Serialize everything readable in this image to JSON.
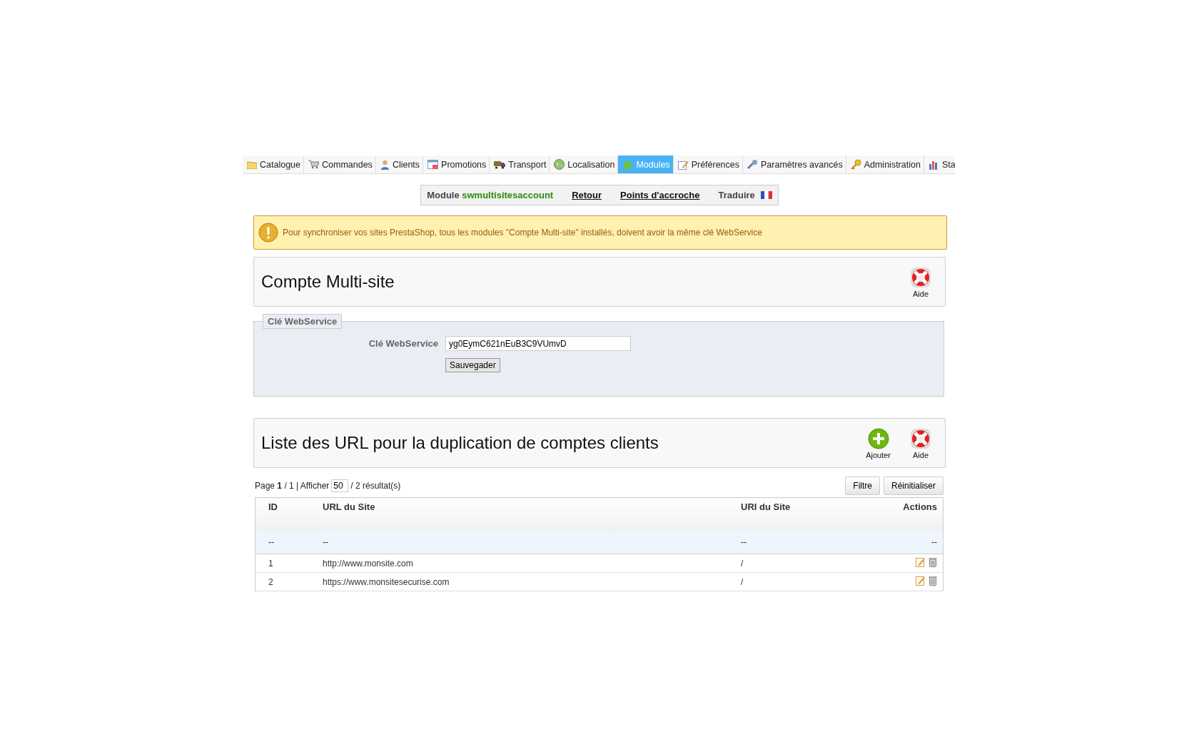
{
  "tabs": [
    {
      "label": "Catalogue",
      "kind": "folder",
      "selected": false
    },
    {
      "label": "Commandes",
      "kind": "cart",
      "selected": false
    },
    {
      "label": "Clients",
      "kind": "person",
      "selected": false
    },
    {
      "label": "Promotions",
      "kind": "promo",
      "selected": false
    },
    {
      "label": "Transport",
      "kind": "truck",
      "selected": false
    },
    {
      "label": "Localisation",
      "kind": "globe",
      "selected": false
    },
    {
      "label": "Modules",
      "kind": "puzzle",
      "selected": true
    },
    {
      "label": "Préférences",
      "kind": "pencil",
      "selected": false
    },
    {
      "label": "Paramètres avancés",
      "kind": "wrench",
      "selected": false
    },
    {
      "label": "Administration",
      "kind": "key",
      "selected": false
    },
    {
      "label": "Sta",
      "kind": "chart",
      "selected": false
    }
  ],
  "module_bar": {
    "label": "Module",
    "module_name": "swmultisitesaccount",
    "links": [
      "Retour",
      "Points d'accroche"
    ],
    "translate": "Traduire"
  },
  "alert": "Pour synchroniser vos sites PrestaShop, tous les modules \"Compte Multi-site\" installés, doivent avoir la même clé WebService",
  "account_panel": {
    "title": "Compte Multi-site",
    "actions": [
      {
        "kind": "help",
        "label": "Aide"
      }
    ]
  },
  "webservice_form": {
    "legend": "Clé WebService",
    "field_label": "Clé WebService",
    "value": "yg0EymC621nEuB3C9VUmvD",
    "button": "Sauvegader"
  },
  "url_panel": {
    "title": "Liste des URL pour la duplication de comptes clients",
    "actions": [
      {
        "kind": "add",
        "label": "Ajouter"
      },
      {
        "kind": "help",
        "label": "Aide"
      }
    ]
  },
  "pagination": {
    "page": "Page **1** / 1 | Afficher",
    "per_page": "50",
    "results": "/ 2 résultat(s)",
    "buttons": [
      "Filtre",
      "Réinitialiser"
    ]
  },
  "table": {
    "columns": [
      "ID",
      "URL du Site",
      "URI du Site",
      "Actions"
    ],
    "filter_row": [
      "--",
      "--",
      "--",
      "--"
    ],
    "rows": [
      {
        "id": "1",
        "url": "http://www.monsite.com",
        "uri": "/"
      },
      {
        "id": "2",
        "url": "https://www.monsitesecurise.com",
        "uri": "/"
      }
    ]
  }
}
